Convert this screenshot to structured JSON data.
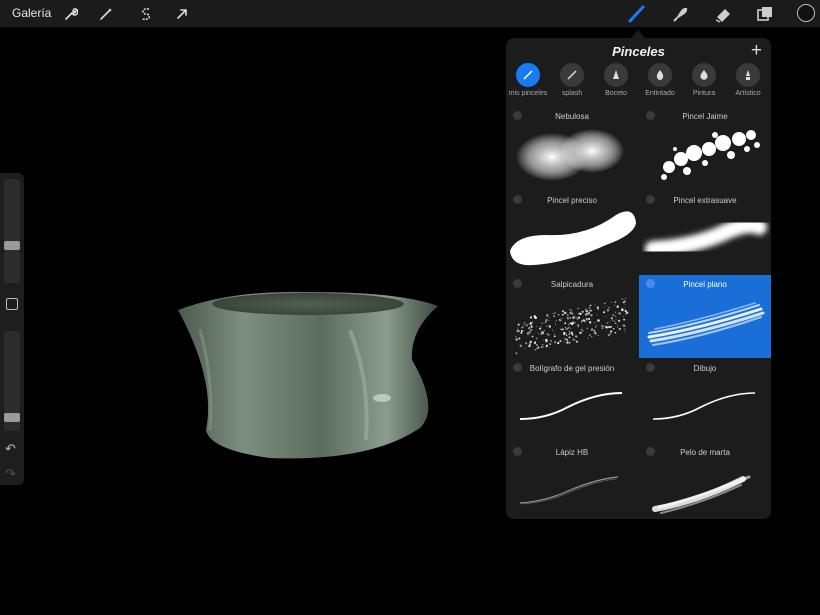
{
  "topbar": {
    "gallery_label": "Galería",
    "left_tools": [
      "wrench-icon",
      "magic-wand-icon",
      "selection-s-icon",
      "transform-arrow-icon"
    ],
    "right_tools": [
      "brush-icon",
      "smudge-icon",
      "eraser-icon",
      "layers-icon"
    ],
    "accent_color": "#1a7cf5"
  },
  "panel": {
    "title": "Pinceles",
    "add_icon": "+",
    "sets": [
      {
        "label": "mis pinceles",
        "active": true
      },
      {
        "label": "splash",
        "active": false
      },
      {
        "label": "Boceto",
        "active": false
      },
      {
        "label": "Entintado",
        "active": false
      },
      {
        "label": "Pintura",
        "active": false
      },
      {
        "label": "Artístico",
        "active": false
      }
    ],
    "brushes": [
      {
        "name": "Nebulosa",
        "selected": false
      },
      {
        "name": "Pincel Jaime",
        "selected": false
      },
      {
        "name": "Pincel preciso",
        "selected": false
      },
      {
        "name": "Pincel extrasuave",
        "selected": false
      },
      {
        "name": "Salpicadura",
        "selected": false
      },
      {
        "name": "Pincel plano",
        "selected": true
      },
      {
        "name": "Bolígrafo de gel presión",
        "selected": false
      },
      {
        "name": "Dibujo",
        "selected": false
      },
      {
        "name": "Lápiz HB",
        "selected": false
      },
      {
        "name": "Pelo de marta",
        "selected": false
      }
    ]
  },
  "sidebar": {
    "brush_size_level": 0.35,
    "opacity_level": 0.1
  }
}
